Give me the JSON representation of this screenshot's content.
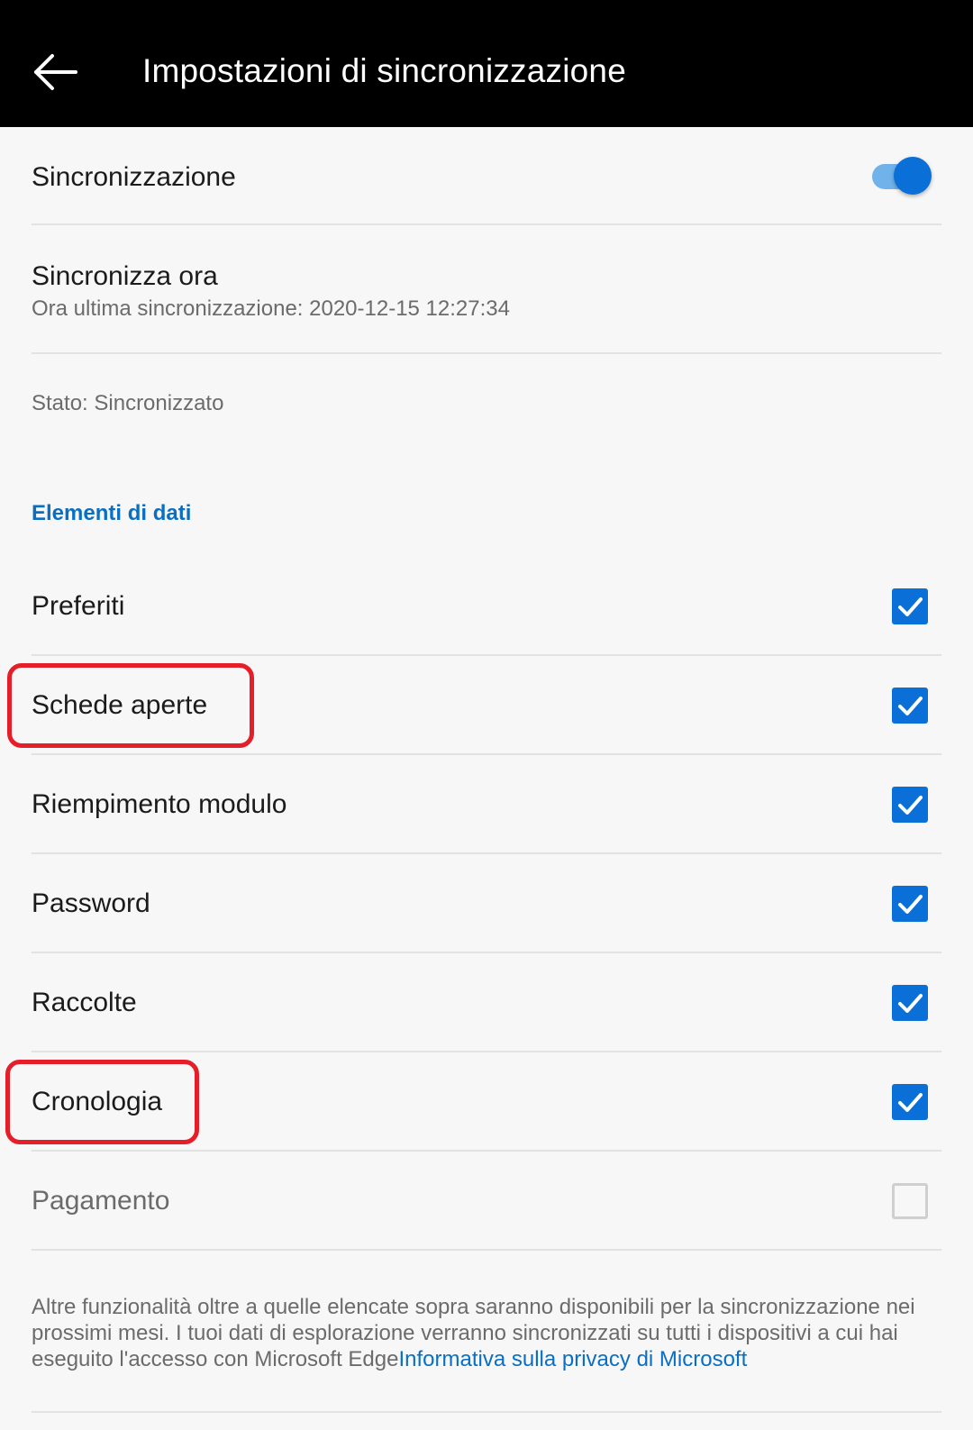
{
  "appbar": {
    "title": "Impostazioni di sincronizzazione",
    "back_icon": "arrow-left-icon"
  },
  "sync": {
    "label": "Sincronizzazione",
    "enabled": true,
    "accent_color": "#0a6fd6"
  },
  "sync_now": {
    "label": "Sincronizza ora",
    "last_sync": "Ora ultima sincronizzazione: 2020-12-15 12:27:34"
  },
  "status": {
    "text": "Stato: Sincronizzato"
  },
  "data_items": {
    "section_title": "Elementi di dati",
    "items": [
      {
        "label": "Preferiti",
        "checked": true,
        "highlighted": false
      },
      {
        "label": "Schede aperte",
        "checked": true,
        "highlighted": true
      },
      {
        "label": "Riempimento modulo",
        "checked": true,
        "highlighted": false
      },
      {
        "label": "Password",
        "checked": true,
        "highlighted": false
      },
      {
        "label": "Raccolte",
        "checked": true,
        "highlighted": false
      },
      {
        "label": "Cronologia",
        "checked": true,
        "highlighted": true
      },
      {
        "label": "Pagamento",
        "checked": false,
        "highlighted": false
      }
    ]
  },
  "footer": {
    "text": "Altre funzionalità oltre a quelle elencate sopra saranno disponibili per la sincronizzazione nei prossimi mesi. I tuoi dati di esplorazione verranno sincronizzati su tutti i dispositivi a cui hai eseguito l'accesso con Microsoft Edge",
    "link": "Informativa sulla privacy di Microsoft"
  },
  "colors": {
    "highlight": "#e51f2a",
    "link": "#0a6fc2"
  }
}
